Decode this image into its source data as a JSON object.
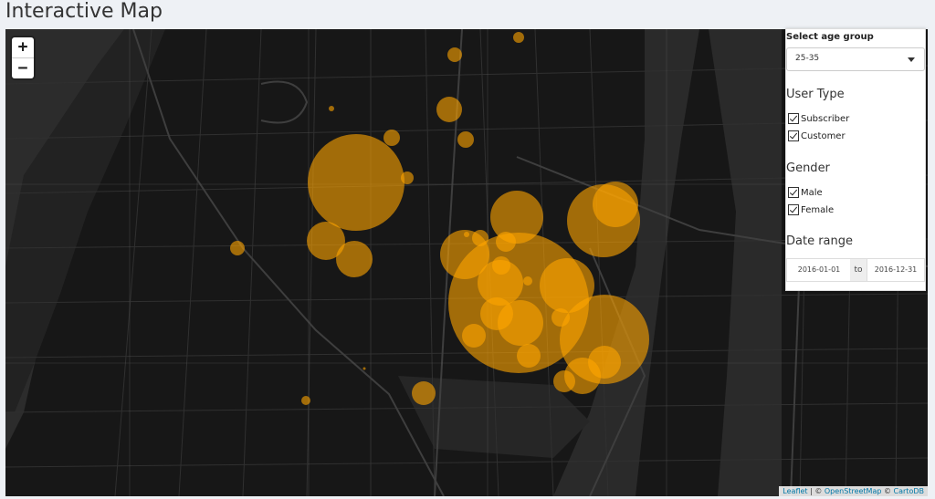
{
  "page": {
    "title": "Interactive Map"
  },
  "zoom": {
    "in_label": "+",
    "out_label": "−"
  },
  "panel": {
    "age_label": "Select age group",
    "age_value": "25-35",
    "user_type_title": "User Type",
    "user_types": [
      {
        "label": "Subscriber",
        "checked": true
      },
      {
        "label": "Customer",
        "checked": true
      }
    ],
    "gender_title": "Gender",
    "genders": [
      {
        "label": "Male",
        "checked": true
      },
      {
        "label": "Female",
        "checked": true
      }
    ],
    "date_title": "Date range",
    "date_from": "2016-01-01",
    "date_sep": "to",
    "date_to": "2016-12-31"
  },
  "attribution": {
    "leaflet": "Leaflet",
    "sep1": " | © ",
    "osm": "OpenStreetMap",
    "sep2": " © ",
    "carto": "CartoDB"
  },
  "colors": {
    "marker": "#ffa500",
    "map_bg": "#161616"
  },
  "map_markers_note": "orange circle markers of varying size"
}
